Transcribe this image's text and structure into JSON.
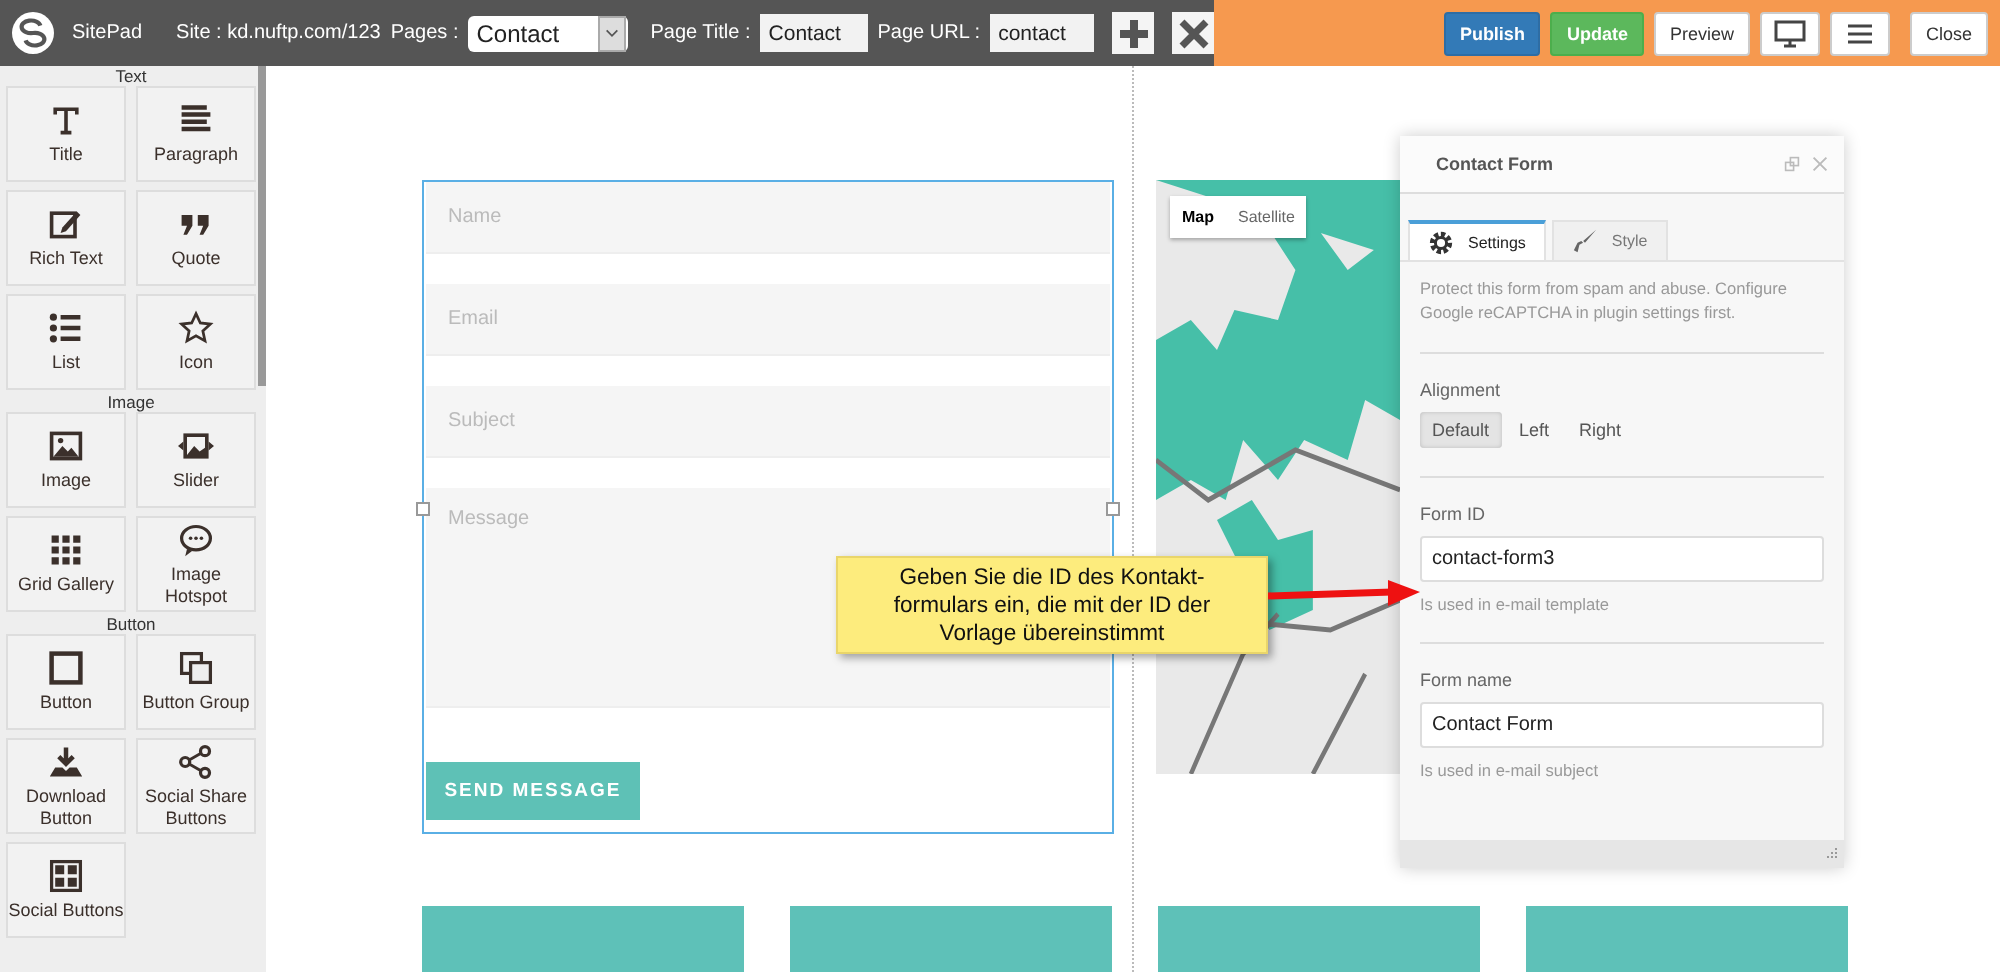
{
  "app": {
    "name": "SitePad",
    "site": "Site : kd.nuftp.com/123",
    "pages_label": "Pages :",
    "pages_value": "Contact",
    "page_title_label": "Page Title :",
    "page_title_value": "Contact",
    "page_url_label": "Page URL :",
    "page_url_value": "contact"
  },
  "toolbar_buttons": [
    {
      "label": "Publish",
      "kind": "primary"
    },
    {
      "label": "Update",
      "kind": "success"
    },
    {
      "label": "Preview",
      "kind": "plain"
    },
    {
      "kind": "desktop"
    },
    {
      "kind": "menu"
    },
    {
      "label": "Close",
      "kind": "close"
    }
  ],
  "sidebar": [
    {
      "title": "Text",
      "widgets": [
        {
          "label": "Title",
          "kind": "title"
        },
        {
          "label": "Paragraph",
          "kind": "paragraph"
        },
        {
          "label": "Rich Text",
          "kind": "richtext"
        },
        {
          "label": "Quote",
          "kind": "quote"
        },
        {
          "label": "List",
          "kind": "list"
        },
        {
          "label": "Icon",
          "kind": "star"
        }
      ]
    },
    {
      "title": "Image",
      "widgets": [
        {
          "label": "Image",
          "kind": "image"
        },
        {
          "label": "Slider",
          "kind": "slider"
        },
        {
          "label": "Grid Gallery",
          "kind": "grid"
        },
        {
          "label": "Image Hotspot",
          "kind": "hotspot"
        }
      ]
    },
    {
      "title": "Button",
      "widgets": [
        {
          "label": "Button",
          "kind": "button"
        },
        {
          "label": "Button Group",
          "kind": "buttongroup"
        },
        {
          "label": "Download Button",
          "kind": "download"
        },
        {
          "label": "Social Share Buttons",
          "kind": "share"
        },
        {
          "label": "Social Buttons",
          "kind": "social"
        }
      ]
    }
  ],
  "form": {
    "fields": [
      {
        "placeholder": "Name",
        "kind": "input"
      },
      {
        "placeholder": "Email",
        "kind": "input"
      },
      {
        "placeholder": "Subject",
        "kind": "input"
      },
      {
        "placeholder": "Message",
        "kind": "textarea"
      }
    ],
    "submit": "SEND MESSAGE"
  },
  "map": {
    "tabs": [
      {
        "label": "Map",
        "selected": true
      },
      {
        "label": "Satellite",
        "selected": false
      }
    ]
  },
  "panel": {
    "title": "Contact Form",
    "tabs": [
      {
        "label": "Settings",
        "kind": "gear",
        "selected": true
      },
      {
        "label": "Style",
        "kind": "brush",
        "selected": false
      }
    ],
    "notice": "Protect this form from spam and abuse. Configure Google reCAPTCHA in plugin settings first.",
    "alignment": {
      "label": "Alignment",
      "options": [
        {
          "label": "Default",
          "selected": true
        },
        {
          "label": "Left",
          "selected": false
        },
        {
          "label": "Right",
          "selected": false
        }
      ]
    },
    "fields": [
      {
        "label": "Form ID",
        "value": "contact-form3",
        "help": "Is used in e-mail template"
      },
      {
        "label": "Form name",
        "value": "Contact Form",
        "help": "Is used in e-mail subject"
      }
    ]
  },
  "callout": {
    "text": "Geben Sie die ID des Kontakt-\nformulars ein, die mit der ID der\nVorlage übereinstimmt"
  }
}
